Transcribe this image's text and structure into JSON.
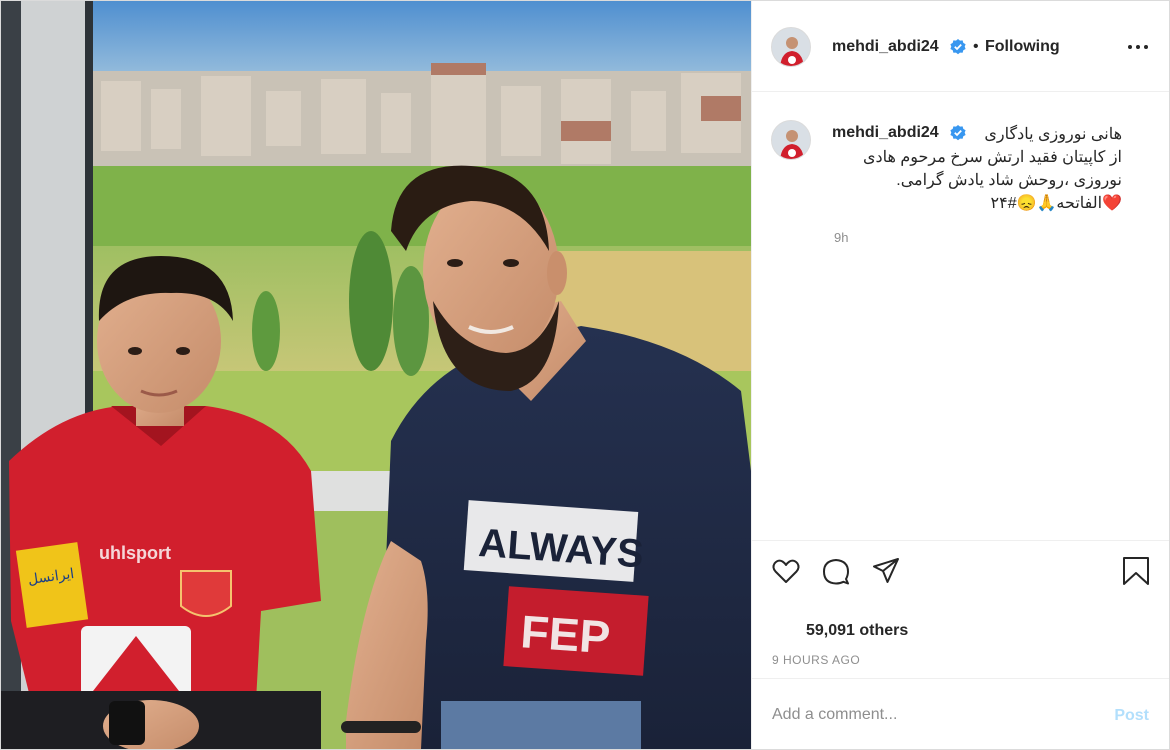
{
  "header": {
    "username": "mehdi_abdi24",
    "separator": "•",
    "follow_status": "Following"
  },
  "caption": {
    "username": "mehdi_abdi24",
    "lines": [
      "هانی نوروزی یادگاری",
      "از کاپیتان فقید ارتش سرخ مرحوم هادی",
      "نوروزی ،روحش شاد یادش گرامی.",
      "❤️الفاتحه🙏😞#۲۴"
    ],
    "time": "9h"
  },
  "photo": {
    "jersey_sponsor": "uhlsport",
    "shirt_text_top": "ALWAYS",
    "shirt_text_bottom": "FEP",
    "sleeve_text": "ایرانسل"
  },
  "actions": {
    "like_icon": "heart-icon",
    "comment_icon": "comment-icon",
    "share_icon": "share-icon",
    "save_icon": "bookmark-icon"
  },
  "likes_text": "59,091 others",
  "posted_ago": "9 HOURS AGO",
  "comment_box": {
    "placeholder": "Add a comment...",
    "post_label": "Post"
  },
  "colors": {
    "verified_badge": "#3897f0",
    "post_button_disabled": "#b2dffc",
    "jersey_red": "#d11f2d"
  }
}
